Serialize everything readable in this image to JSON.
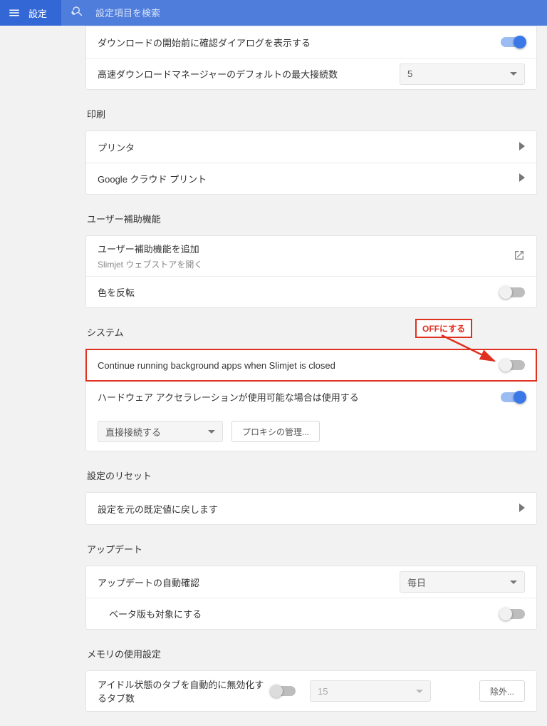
{
  "header": {
    "title": "設定",
    "search_placeholder": "設定項目を検索"
  },
  "downloads": {
    "confirm_label": "ダウンロードの開始前に確認ダイアログを表示する",
    "max_conn_label": "高速ダウンロードマネージャーのデフォルトの最大接続数",
    "max_conn_value": "5"
  },
  "print": {
    "title": "印刷",
    "printer": "プリンタ",
    "google_cloud": "Google クラウド プリント"
  },
  "accessibility": {
    "title": "ユーザー補助機能",
    "add_label": "ユーザー補助機能を追加",
    "add_sub": "Slimjet ウェブストアを開く",
    "invert": "色を反転"
  },
  "system": {
    "title": "システム",
    "bg_label": "Continue running background apps when Slimjet is closed",
    "hw_label": "ハードウェア アクセラレーションが使用可能な場合は使用する",
    "proxy_mode": "直接接続する",
    "proxy_btn": "プロキシの管理..."
  },
  "reset": {
    "title": "設定のリセット",
    "row": "設定を元の既定値に戻します"
  },
  "update": {
    "title": "アップデート",
    "auto_label": "アップデートの自動確認",
    "auto_value": "毎日",
    "beta_label": "ベータ版も対象にする"
  },
  "memory": {
    "title": "メモリの使用設定",
    "idle_label": "アイドル状態のタブを自動的に無効化するタブ数",
    "idle_value": "15",
    "exclude": "除外..."
  },
  "annotation": {
    "label": "OFFにする"
  }
}
